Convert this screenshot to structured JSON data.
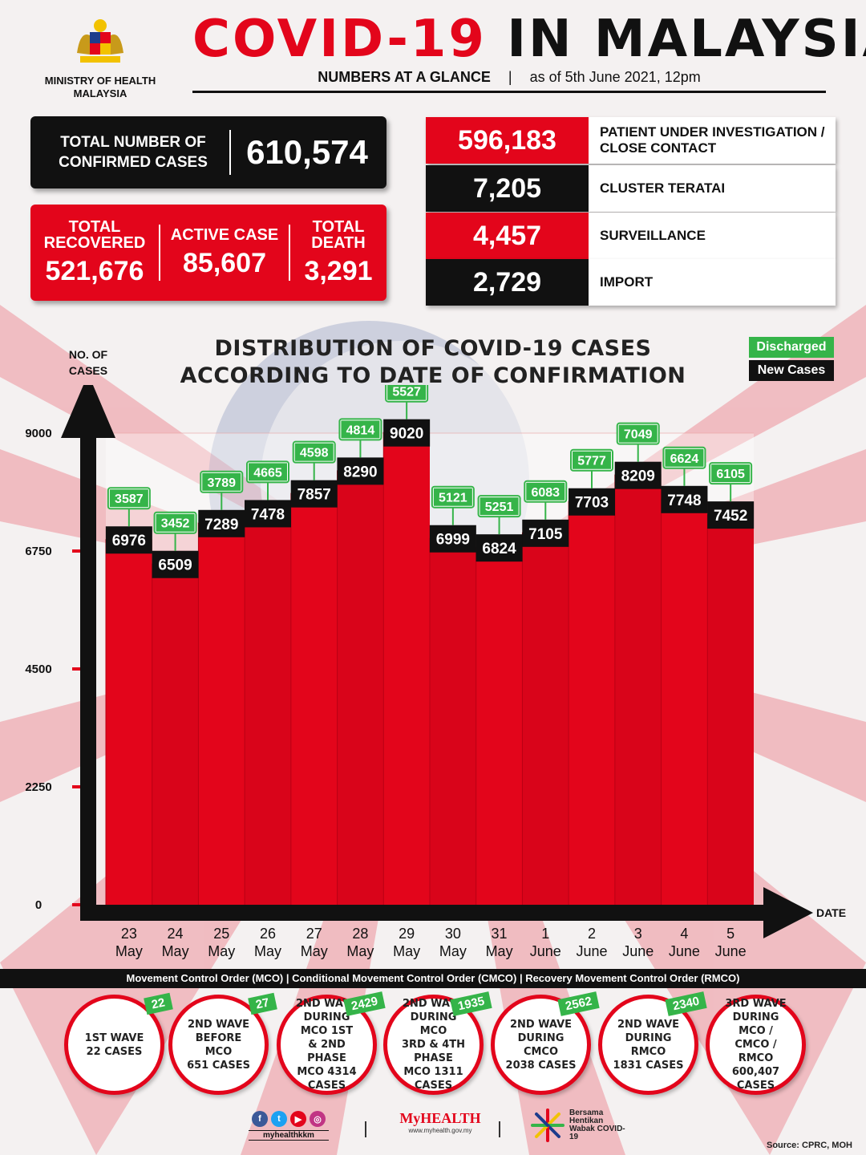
{
  "header": {
    "ministry": "MINISTRY OF HEALTH MALAYSIA",
    "title_part1": "COVID-19",
    "title_part2": "IN MALAYSIA",
    "subtitle": "NUMBERS AT A GLANCE",
    "as_of": "as of 5th June 2021, 12pm"
  },
  "confirmed": {
    "label": "TOTAL NUMBER OF CONFIRMED CASES",
    "value": "610,574"
  },
  "stats": [
    {
      "label": "TOTAL RECOVERED",
      "value": "521,676"
    },
    {
      "label": "ACTIVE CASE",
      "value": "85,607"
    },
    {
      "label": "TOTAL DEATH",
      "value": "3,291"
    }
  ],
  "sources": [
    {
      "value": "596,183",
      "label": "PATIENT UNDER INVESTIGATION / CLOSE CONTACT"
    },
    {
      "value": "7,205",
      "label": "CLUSTER TERATAI"
    },
    {
      "value": "4,457",
      "label": "SURVEILLANCE"
    },
    {
      "value": "2,729",
      "label": "IMPORT"
    }
  ],
  "colors": {
    "red": "#e3051b",
    "black": "#111111",
    "green": "#35b449"
  },
  "chart_data": {
    "type": "bar",
    "title": "DISTRIBUTION OF COVID-19 CASES ACCORDING TO DATE OF CONFIRMATION",
    "ylabel": "NO. OF CASES",
    "xlabel": "DATE",
    "ylim": [
      0,
      9000
    ],
    "yticks": [
      0,
      2250,
      4500,
      6750,
      9000
    ],
    "categories": [
      "23 May",
      "24 May",
      "25 May",
      "26 May",
      "27 May",
      "28 May",
      "29 May",
      "30 May",
      "31 May",
      "1 June",
      "2 June",
      "3 June",
      "4 June",
      "5 June"
    ],
    "series": [
      {
        "name": "New Cases",
        "values": [
          6976,
          6509,
          7289,
          7478,
          7857,
          8290,
          9020,
          6999,
          6824,
          7105,
          7703,
          8209,
          7748,
          7452
        ]
      },
      {
        "name": "Discharged",
        "values": [
          3587,
          3452,
          3789,
          4665,
          4598,
          4814,
          5527,
          5121,
          5251,
          6083,
          5777,
          7049,
          6624,
          6105
        ]
      }
    ],
    "legend": [
      "Discharged",
      "New Cases"
    ],
    "legend_position": "top-right"
  },
  "footer": {
    "bar_text": "Movement Control Order (MCO) | Conditional Movement Control Order (CMCO) | Recovery Movement Control Order (RMCO)",
    "waves": [
      {
        "text": "1ST WAVE\n22 CASES",
        "badge": "22"
      },
      {
        "text": "2ND WAVE\nBEFORE MCO\n651 CASES",
        "badge": "27"
      },
      {
        "text": "2ND WAVE\nDURING MCO 1ST\n& 2ND PHASE\nMCO 4314\nCASES",
        "badge": "2429"
      },
      {
        "text": "2ND WAVE\nDURING MCO\n3RD & 4TH PHASE\nMCO 1311\nCASES",
        "badge": "1935"
      },
      {
        "text": "2ND WAVE\nDURING CMCO\n2038 CASES",
        "badge": "2562"
      },
      {
        "text": "2ND WAVE\nDURING RMCO\n1831 CASES",
        "badge": "2340"
      },
      {
        "text": "3RD WAVE\nDURING MCO /\nCMCO / RMCO\n600,407\nCASES",
        "badge": ""
      }
    ],
    "social_handle": "myhealthkkm",
    "myhealth": "MyHEALTH",
    "myhealth_url": "www.myhealth.gov.my",
    "bersama": "Bersama Hentikan Wabak COVID-19",
    "source": "Source: CPRC, MOH"
  }
}
